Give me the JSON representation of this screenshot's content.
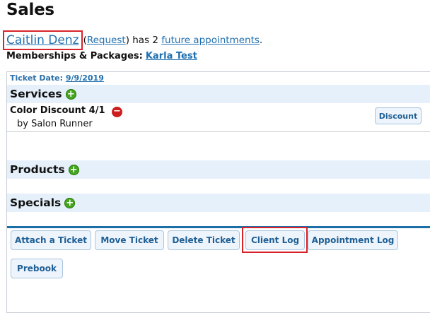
{
  "page": {
    "title": "Sales"
  },
  "client": {
    "name": "Caitlin Denz",
    "request_open": "(",
    "request_label": "Request",
    "request_close": ") has 2 ",
    "appointments_label": "future appointments",
    "period": "."
  },
  "memberships": {
    "label": "Memberships & Packages:",
    "value": "Karla Test"
  },
  "ticket": {
    "date_label": "Ticket Date:",
    "date_value": "9/9/2019"
  },
  "sections": {
    "services": "Services",
    "products": "Products",
    "specials": "Specials"
  },
  "service_item": {
    "name": "Color Discount 4/1",
    "by": "by Salon Runner",
    "discount_button": "Discount"
  },
  "actions": {
    "attach": "Attach a Ticket",
    "move": "Move Ticket",
    "delete": "Delete Ticket",
    "client_log": "Client Log",
    "appointment_log": "Appointment Log",
    "prebook": "Prebook"
  },
  "icons": {
    "add": "+",
    "remove": "−"
  },
  "colors": {
    "link": "#1f6fb0",
    "section_bg": "#e5f0fa",
    "highlight": "#d8232a",
    "add_icon": "#45a51f",
    "remove_icon": "#cc1e1e",
    "rule": "#1c6fa6"
  }
}
